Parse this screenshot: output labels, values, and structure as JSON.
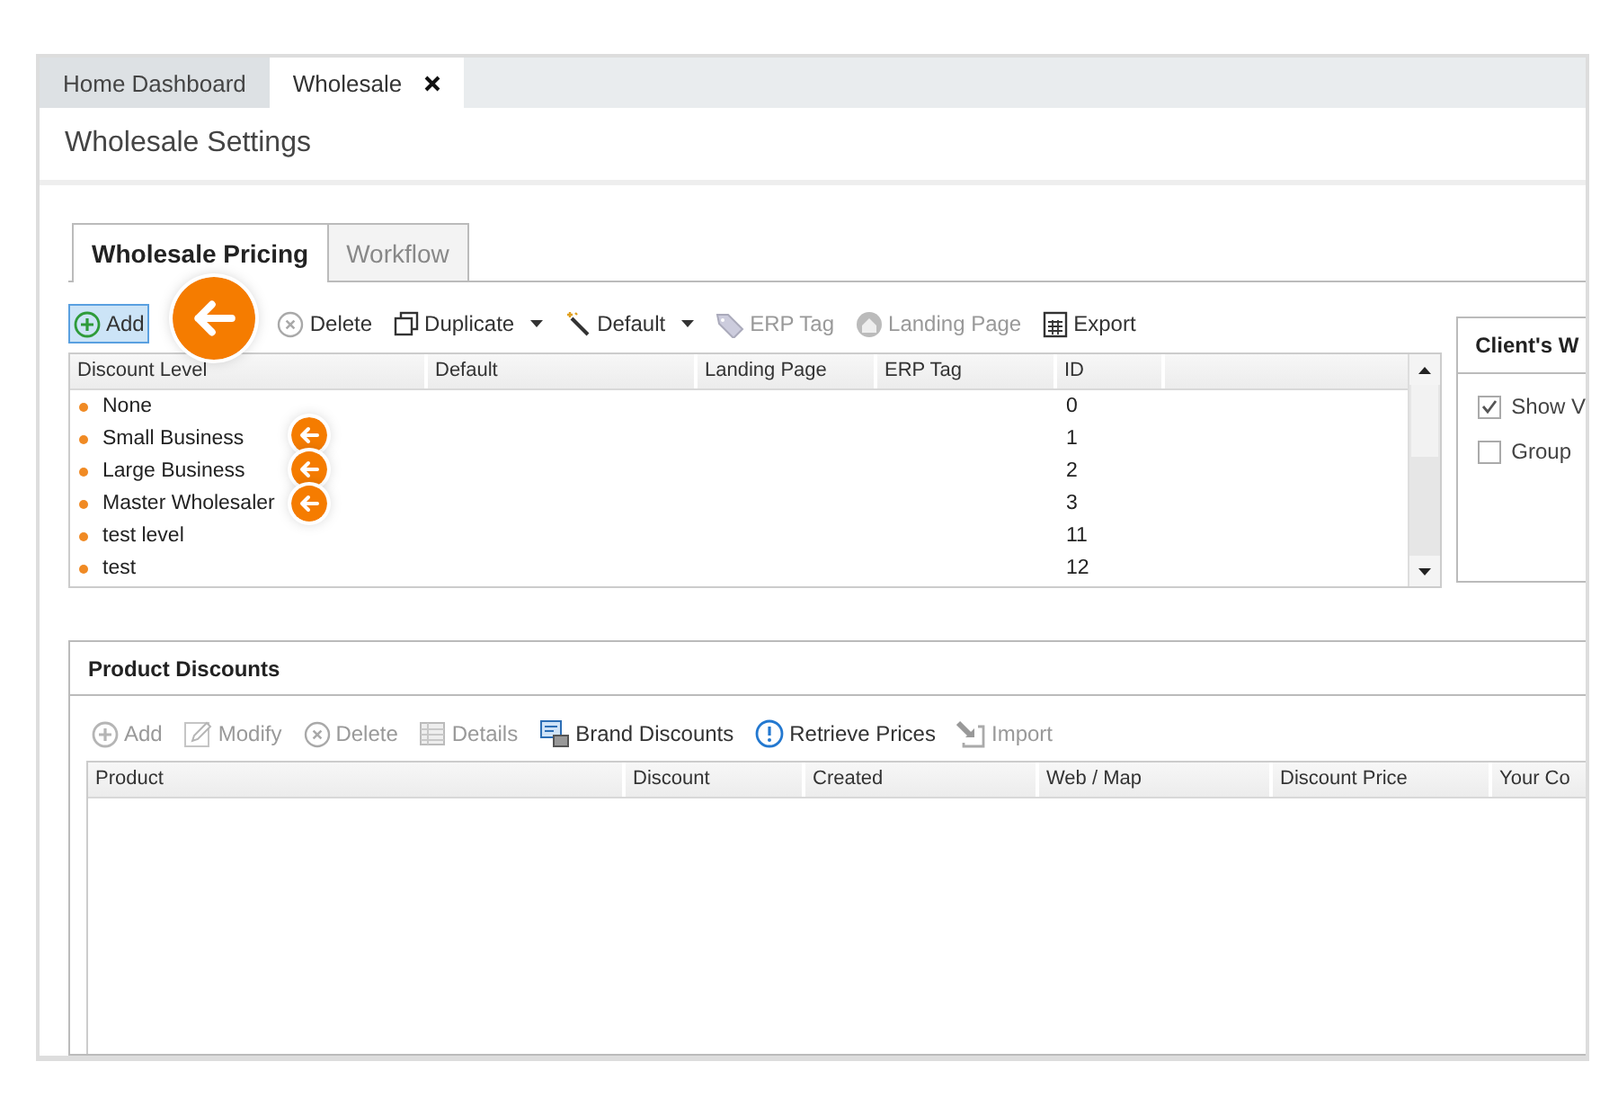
{
  "window_tabs": [
    {
      "label": "Home Dashboard",
      "selected": false,
      "closable": false
    },
    {
      "label": "Wholesale",
      "selected": true,
      "closable": true
    }
  ],
  "page_title": "Wholesale Settings",
  "section_tabs": [
    {
      "label": "Wholesale Pricing",
      "selected": true
    },
    {
      "label": "Workflow",
      "selected": false
    }
  ],
  "levels_toolbar": [
    {
      "label": "Add",
      "kind": "add",
      "active": true,
      "disabled": false,
      "dropdown": false
    },
    {
      "label": "Delete",
      "kind": "delete",
      "active": false,
      "disabled": false,
      "dropdown": false
    },
    {
      "label": "Duplicate",
      "kind": "duplicate",
      "active": false,
      "disabled": false,
      "dropdown": true
    },
    {
      "label": "Default",
      "kind": "wand",
      "active": false,
      "disabled": false,
      "dropdown": true
    },
    {
      "label": "ERP Tag",
      "kind": "tag",
      "active": false,
      "disabled": true,
      "dropdown": false
    },
    {
      "label": "Landing Page",
      "kind": "home",
      "active": false,
      "disabled": true,
      "dropdown": false
    },
    {
      "label": "Export",
      "kind": "table",
      "active": false,
      "disabled": false,
      "dropdown": false
    }
  ],
  "levels_grid": {
    "columns": [
      "Discount Level",
      "Default",
      "Landing Page",
      "ERP Tag",
      "ID"
    ],
    "rows": [
      {
        "discount_level": "None",
        "id": "0"
      },
      {
        "discount_level": "Small Business",
        "id": "1"
      },
      {
        "discount_level": "Large Business",
        "id": "2"
      },
      {
        "discount_level": "Master Wholesaler",
        "id": "3"
      },
      {
        "discount_level": "test level",
        "id": "11"
      },
      {
        "discount_level": "test",
        "id": "12"
      }
    ]
  },
  "client_panel": {
    "title": "Client's W",
    "options": [
      {
        "label": "Show V",
        "checked": true
      },
      {
        "label": "Group",
        "checked": false
      }
    ]
  },
  "product_discounts": {
    "title": "Product Discounts",
    "toolbar": [
      {
        "label": "Add",
        "kind": "add",
        "active": false,
        "disabled": true,
        "dropdown": false
      },
      {
        "label": "Modify",
        "kind": "edit",
        "active": false,
        "disabled": true,
        "dropdown": false
      },
      {
        "label": "Delete",
        "kind": "delete",
        "active": false,
        "disabled": true,
        "dropdown": false
      },
      {
        "label": "Details",
        "kind": "details",
        "active": false,
        "disabled": true,
        "dropdown": false
      },
      {
        "label": "Brand Discounts",
        "kind": "brand",
        "active": false,
        "disabled": false,
        "dropdown": false
      },
      {
        "label": "Retrieve Prices",
        "kind": "info",
        "active": false,
        "disabled": false,
        "dropdown": false
      },
      {
        "label": "Import",
        "kind": "import",
        "active": false,
        "disabled": true,
        "dropdown": false
      }
    ],
    "columns": [
      "Product",
      "Discount",
      "Created",
      "Web / Map",
      "Discount Price",
      "Your Co"
    ]
  }
}
